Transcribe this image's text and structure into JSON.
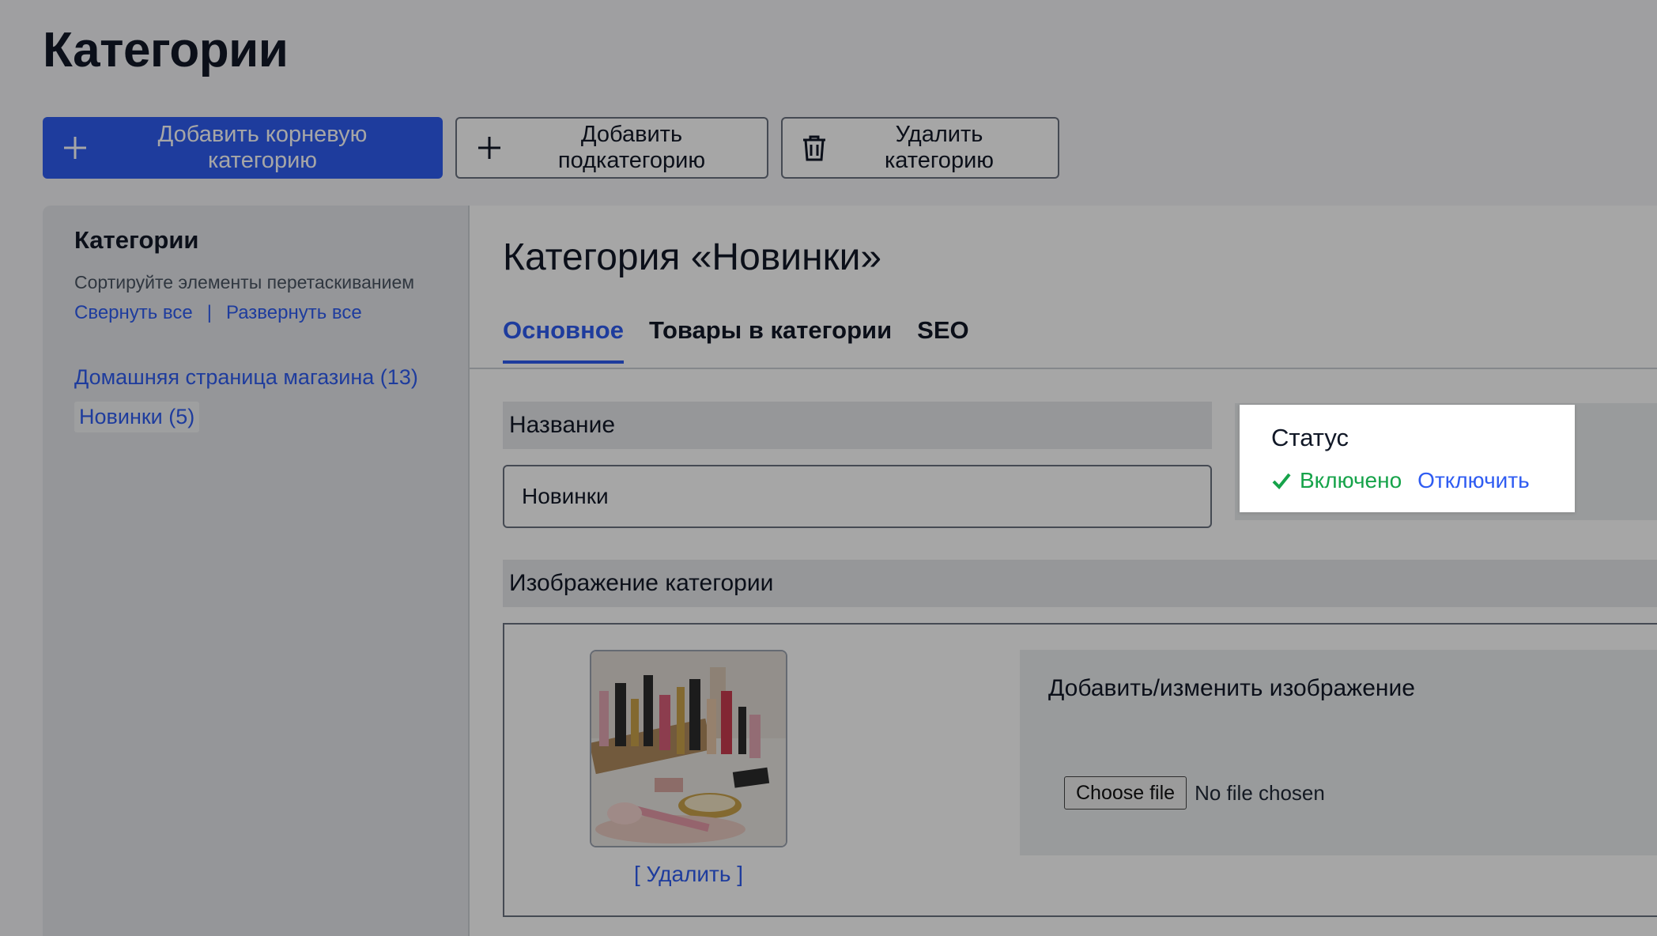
{
  "page": {
    "title": "Категории"
  },
  "toolbar": {
    "add_root_label": "Добавить корневую категорию",
    "add_sub_label": "Добавить подкатегорию",
    "delete_label": "Удалить категорию"
  },
  "sidebar": {
    "title": "Категории",
    "hint": "Сортируйте элементы перетаскиванием",
    "collapse_all": "Свернуть все",
    "separator": "|",
    "expand_all": "Развернуть все",
    "items": [
      {
        "label": "Домашняя страница магазина (13)"
      },
      {
        "label": "Новинки (5)"
      }
    ]
  },
  "main": {
    "title": "Категория «Новинки»",
    "tabs": [
      {
        "label": "Основное",
        "active": true
      },
      {
        "label": "Товары в категории"
      },
      {
        "label": "SEO"
      }
    ],
    "name_section": "Название",
    "name_value": "Новинки",
    "status": {
      "label": "Статус",
      "enabled": "Включено",
      "disable": "Отключить"
    },
    "image_section": "Изображение категории",
    "delete_image": "[ Удалить ]",
    "upload": {
      "title": "Добавить/изменить изображение",
      "choose_file": "Choose file",
      "no_file": "No file chosen"
    }
  },
  "colors": {
    "accent": "#2f5cf2",
    "status_on": "#16a34a",
    "overlay": "rgba(0,0,0,0.35)"
  }
}
